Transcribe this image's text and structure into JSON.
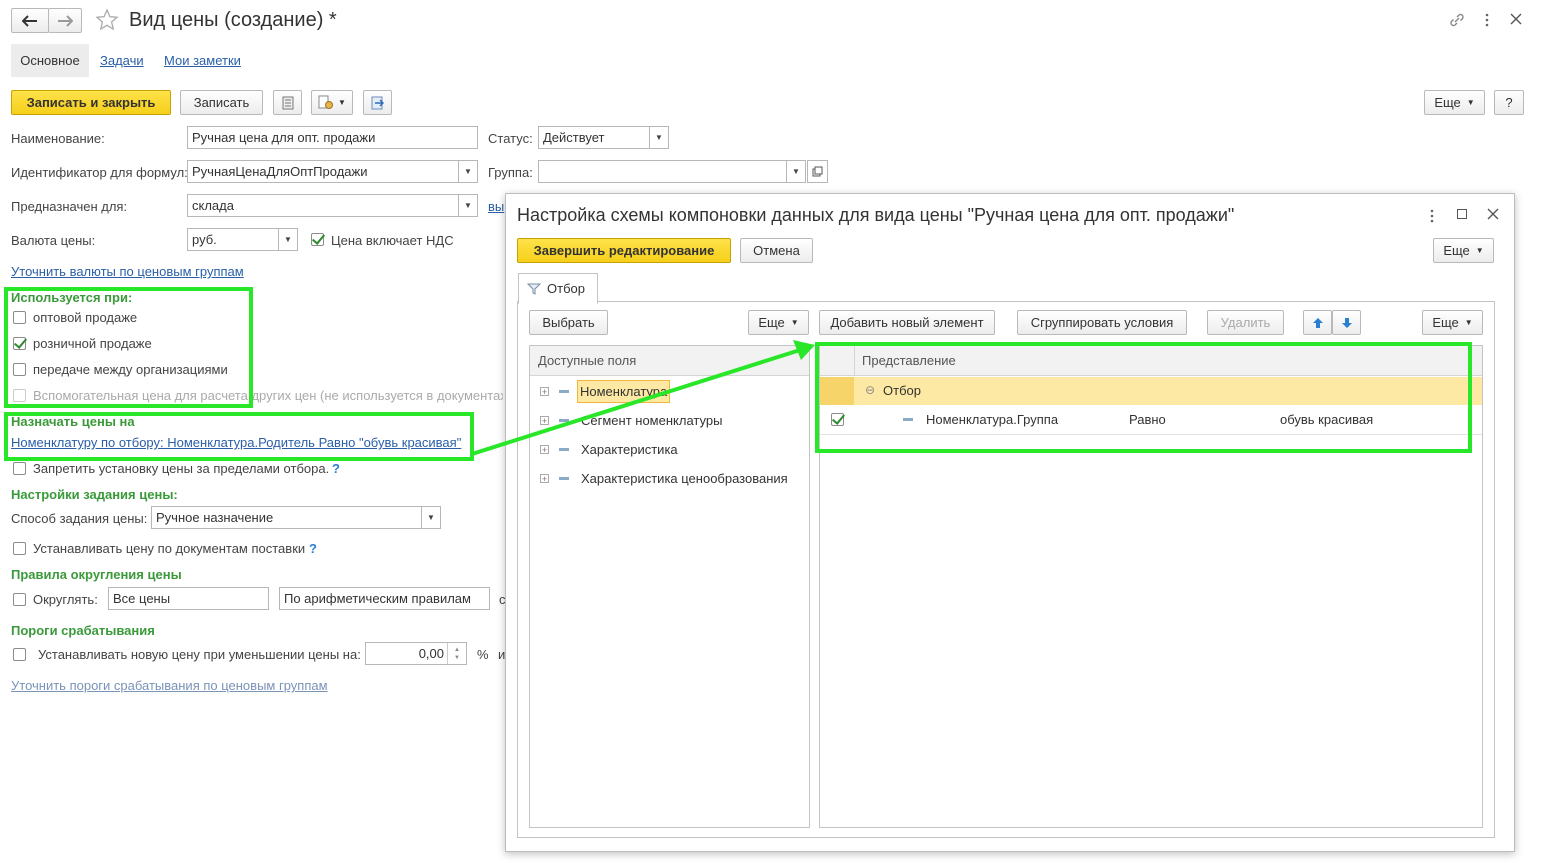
{
  "window": {
    "title": "Вид цены (создание) *"
  },
  "tabs": [
    "Основное",
    "Задачи",
    "Мои заметки"
  ],
  "toolbar": {
    "save_close": "Записать и закрыть",
    "save": "Записать",
    "more": "Еще",
    "help": "?"
  },
  "form": {
    "name_label": "Наименование:",
    "name_value": "Ручная цена для опт. продажи",
    "status_label": "Статус:",
    "status_value": "Действует",
    "formula_id_label": "Идентификатор для формул:",
    "formula_id_value": "РучнаяЦенаДляОптПродажи",
    "group_label": "Группа:",
    "group_value": "",
    "purpose_label": "Предназначен для:",
    "purpose_value": "склада",
    "purpose_link_fragment": "вы",
    "currency_label": "Валюта цены:",
    "currency_value": "руб.",
    "vat_label": "Цена включает НДС",
    "currency_groups_link": "Уточнить валюты по ценовым группам",
    "used_when_header": "Используется при:",
    "used_when": [
      {
        "label": "оптовой продаже",
        "checked": false
      },
      {
        "label": "розничной продаже",
        "checked": true
      },
      {
        "label": "передаче между организациями",
        "checked": false
      },
      {
        "label": "Вспомогательная цена для расчета других цен (не используется в документах)",
        "checked": false
      }
    ],
    "assign_header": "Назначать цены на",
    "assign_link": "Номенклатуру по отбору: Номенклатура.Родитель Равно \"обувь красивая\"",
    "forbid_label": "Запретить установку цены за пределами отбора.",
    "price_settings_header": "Настройки задания цены:",
    "method_label": "Способ задания цены:",
    "method_value": "Ручное назначение",
    "supply_docs_label": "Устанавливать цену по документам поставки",
    "rounding_header": "Правила округления цены",
    "round_label": "Округлять:",
    "round_scope_value": "Все цены",
    "round_rule_value": "По арифметическим правилам",
    "round_fragment": "с",
    "thresholds_header": "Пороги срабатывания",
    "threshold_label": "Устанавливать новую цену при уменьшении цены на:",
    "threshold_value": "0,00",
    "threshold_unit": "%",
    "threshold_fragment": "и",
    "thresholds_link": "Уточнить пороги срабатывания по ценовым группам",
    "question_mark": "?"
  },
  "dialog": {
    "title": "Настройка схемы компоновки данных для вида цены \"Ручная цена для опт. продажи\"",
    "finish_button": "Завершить редактирование",
    "cancel_button": "Отмена",
    "more": "Еще",
    "tab_filter": "Отбор",
    "choose_button": "Выбрать",
    "add_element_button": "Добавить новый элемент",
    "group_conditions_button": "Сгруппировать условия",
    "delete_button": "Удалить",
    "available_fields_header": "Доступные поля",
    "available_fields": [
      "Номенклатура",
      "Сегмент номенклатуры",
      "Характеристика",
      "Характеристика ценообразования"
    ],
    "representation_header": "Представление",
    "filter_group_label": "Отбор",
    "filter_rows": [
      {
        "field": "Номенклатура.Группа",
        "condition": "Равно",
        "value": "обувь красивая",
        "checked": true
      }
    ]
  },
  "colors": {
    "accent_yellow": "#f5cf1a",
    "highlight_green": "#28e628",
    "section_green": "#3a9a3a",
    "link_blue": "#2a5fa8",
    "row_highlight": "#fde9a3"
  }
}
